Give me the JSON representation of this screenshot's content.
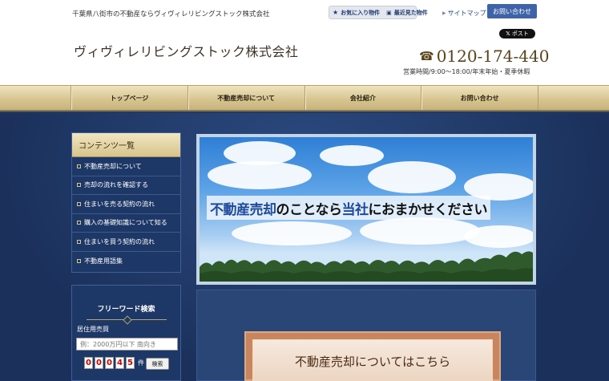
{
  "header": {
    "tagline": "千葉県八街市の不動産ならヴィヴィレリビングストック株式会社",
    "fav_label": "お気に入り物件",
    "recent_label": "最近見た物件",
    "sitemap_label": "サイトマップ",
    "contact_label": "お問い合わせ",
    "post_label": "ポスト",
    "company_name": "ヴィヴィレリビングストック株式会社",
    "phone": "0120-174-440",
    "hours": "営業時間/9:00～18:00/年末年始・夏季休暇"
  },
  "nav": {
    "items": [
      {
        "label": "トップページ"
      },
      {
        "label": "不動産売却について"
      },
      {
        "label": "会社紹介"
      },
      {
        "label": "お問い合わせ"
      }
    ]
  },
  "sidebar": {
    "title": "コンテンツ一覧",
    "items": [
      {
        "label": "不動産売却について"
      },
      {
        "label": "売却の流れを確認する"
      },
      {
        "label": "住まいを売る契約の流れ"
      },
      {
        "label": "購入の基礎知識について知る"
      },
      {
        "label": "住まいを買う契約の流れ"
      },
      {
        "label": "不動産用語集"
      }
    ]
  },
  "search": {
    "title": "フリーワード検索",
    "category": "居住用売買",
    "placeholder": "例：2000万円以下 南向き",
    "count_digits": [
      "0",
      "0",
      "0",
      "4",
      "5"
    ],
    "count_unit": "件",
    "button_label": "検索"
  },
  "banner": {
    "part1": "不動産売却",
    "part2": "のことなら",
    "part3": "当社",
    "part4": "におまかせください"
  },
  "cta": {
    "label": "不動産売却についてはこちら"
  }
}
